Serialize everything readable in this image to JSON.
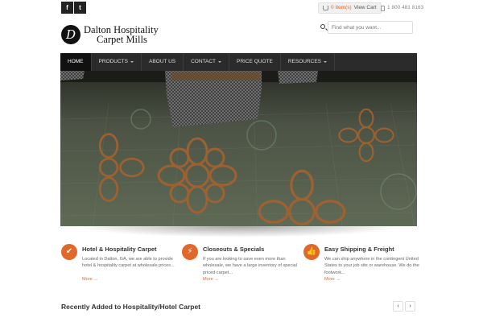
{
  "topbar": {
    "facebook": "f",
    "twitter": "t",
    "cart_items": "0 Item(s)",
    "cart_link": "View Cart",
    "phone": "1 800 481 8163"
  },
  "header": {
    "logo_mark": "D",
    "logo_line1": "Dalton Hospitality",
    "logo_line2": "Carpet Mills",
    "search_placeholder": "Find what you want..."
  },
  "nav": {
    "items": [
      {
        "label": "Home",
        "active": true
      },
      {
        "label": "Products",
        "dropdown": true
      },
      {
        "label": "About Us"
      },
      {
        "label": "Contact",
        "dropdown": true
      },
      {
        "label": "Price Quote"
      },
      {
        "label": "Resources",
        "dropdown": true
      }
    ]
  },
  "features": [
    {
      "icon": "checkmark-icon",
      "symbol": "✔",
      "title": "Hotel & Hospitality Carpet",
      "text": "Located in Dalton, GA, we are able to provide hotel & hospitality carpet at wholesale prices...",
      "more": "More →"
    },
    {
      "icon": "lightning-icon",
      "symbol": "⚡",
      "title": "Closeouts & Specials",
      "text": "If you are looking to save even more than wholesale, we have a large inventory of special priced carpet...",
      "more": "More →"
    },
    {
      "icon": "thumbs-up-icon",
      "symbol": "👍",
      "title": "Easy Shipping & Freight",
      "text": "We can ship anywhere in the contingent United States to your job site or warehouse. We do the footwork...",
      "more": "More →"
    }
  ],
  "recent": {
    "title": "Recently Added to Hospitality/Hotel Carpet",
    "prev": "‹",
    "next": "›"
  },
  "colors": {
    "accent": "#e0682a",
    "nav_bg": "#2b2b2b",
    "nav_active": "#111111"
  }
}
